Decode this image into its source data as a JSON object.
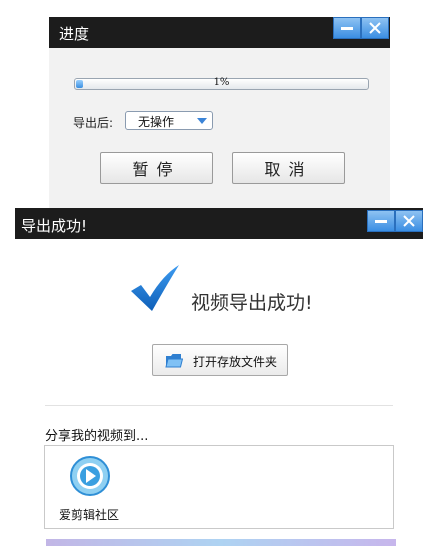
{
  "progress_dialog": {
    "title": "进度",
    "progress": {
      "percent": 1,
      "text": "1%"
    },
    "after_label": "导出后:",
    "after_option": "无操作",
    "pause_label": "暂停",
    "cancel_label": "取消"
  },
  "success_dialog": {
    "title": "导出成功!",
    "message": "视频导出成功!",
    "open_folder_label": "打开存放文件夹",
    "share_title": "分享我的视频到...",
    "share_targets": [
      {
        "label": "爱剪辑社区",
        "icon": "aijianji-community-icon"
      }
    ]
  },
  "colors": {
    "titlebar": "#1c1c1c",
    "window_button": "#3b8ee3",
    "check_mark": "#1a73d1",
    "progress_fill": "#3a8fe0"
  }
}
